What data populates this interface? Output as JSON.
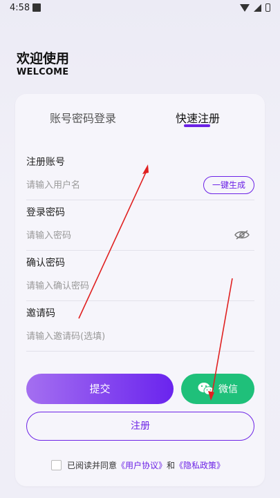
{
  "status_bar": {
    "time": "4:58"
  },
  "header": {
    "title": "欢迎使用",
    "subtitle": "WELCOME"
  },
  "tabs": [
    {
      "label": "账号密码登录",
      "active": false
    },
    {
      "label": "快速注册",
      "active": true
    }
  ],
  "form": {
    "account": {
      "label": "注册账号",
      "placeholder": "请输入用户名",
      "generate_label": "一键生成"
    },
    "password": {
      "label": "登录密码",
      "placeholder": "请输入密码"
    },
    "confirm": {
      "label": "确认密码",
      "placeholder": "请输入确认密码"
    },
    "invite": {
      "label": "邀请码",
      "placeholder": "请输入邀请码(选填)"
    }
  },
  "buttons": {
    "submit": "提交",
    "wechat": "微信",
    "register": "注册"
  },
  "agreement": {
    "prefix": "已阅读并同意",
    "terms": "《用户协议》",
    "and": "和",
    "privacy": "《隐私政策》"
  },
  "colors": {
    "accent": "#6c22e6",
    "wechat": "#1fc07a",
    "annotation": "#e02020"
  }
}
